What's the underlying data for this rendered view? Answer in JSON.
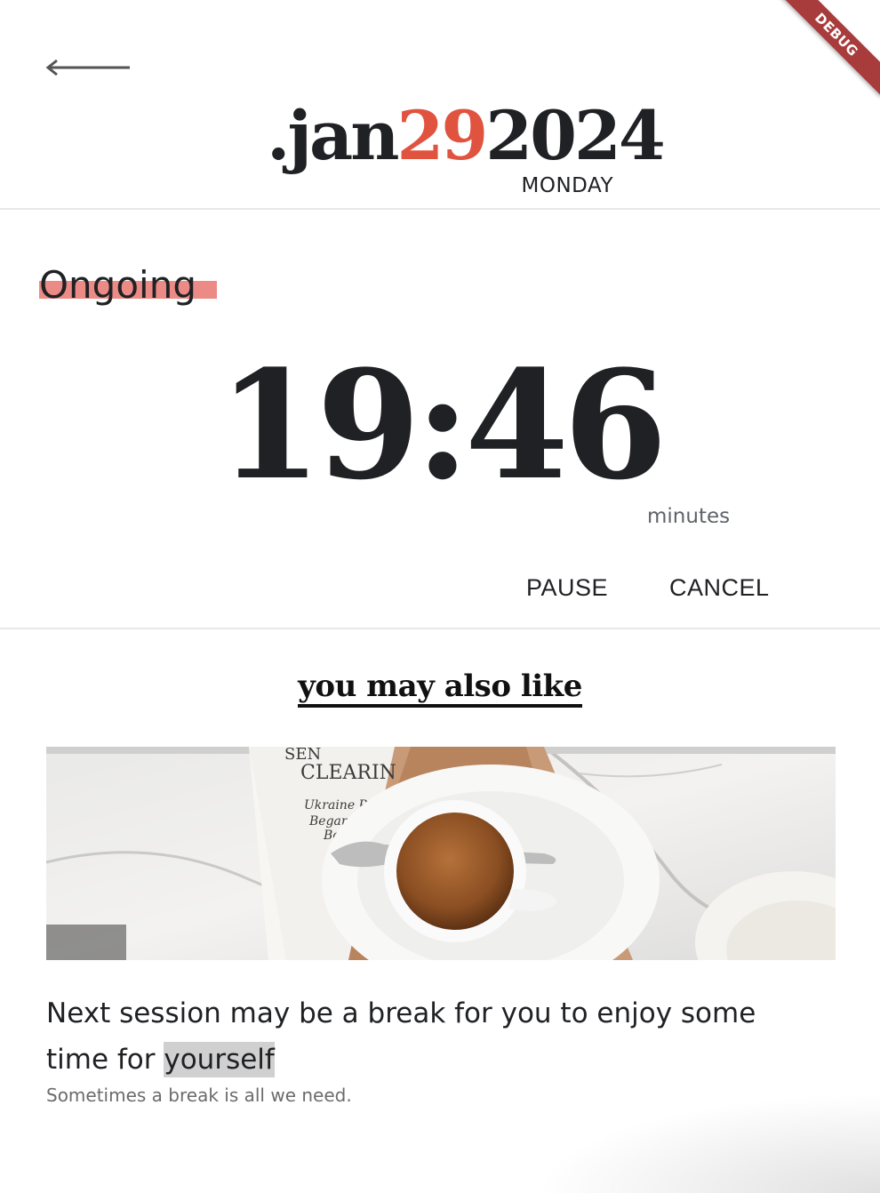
{
  "date": {
    "prefix": ".jan",
    "day": "29",
    "year": "2024",
    "weekday": "MONDAY",
    "accent_color": "#e0533f"
  },
  "timer": {
    "status": "Ongoing",
    "status_highlight_color": "#ec8a85",
    "time": "19:46",
    "unit": "minutes",
    "pause_label": "PAUSE",
    "cancel_label": "CANCEL"
  },
  "suggestion": {
    "section_title": "you may also like",
    "image_icon": "coffee-newspaper-photo",
    "title_before": "Next session may be a break for you to enjoy some time for ",
    "title_highlight": "yourself",
    "subtitle": "Sometimes a break is all we need."
  },
  "debug_banner": {
    "label": "DEBUG",
    "color": "#a83c3c"
  },
  "icons": {
    "back": "back-arrow-icon"
  }
}
